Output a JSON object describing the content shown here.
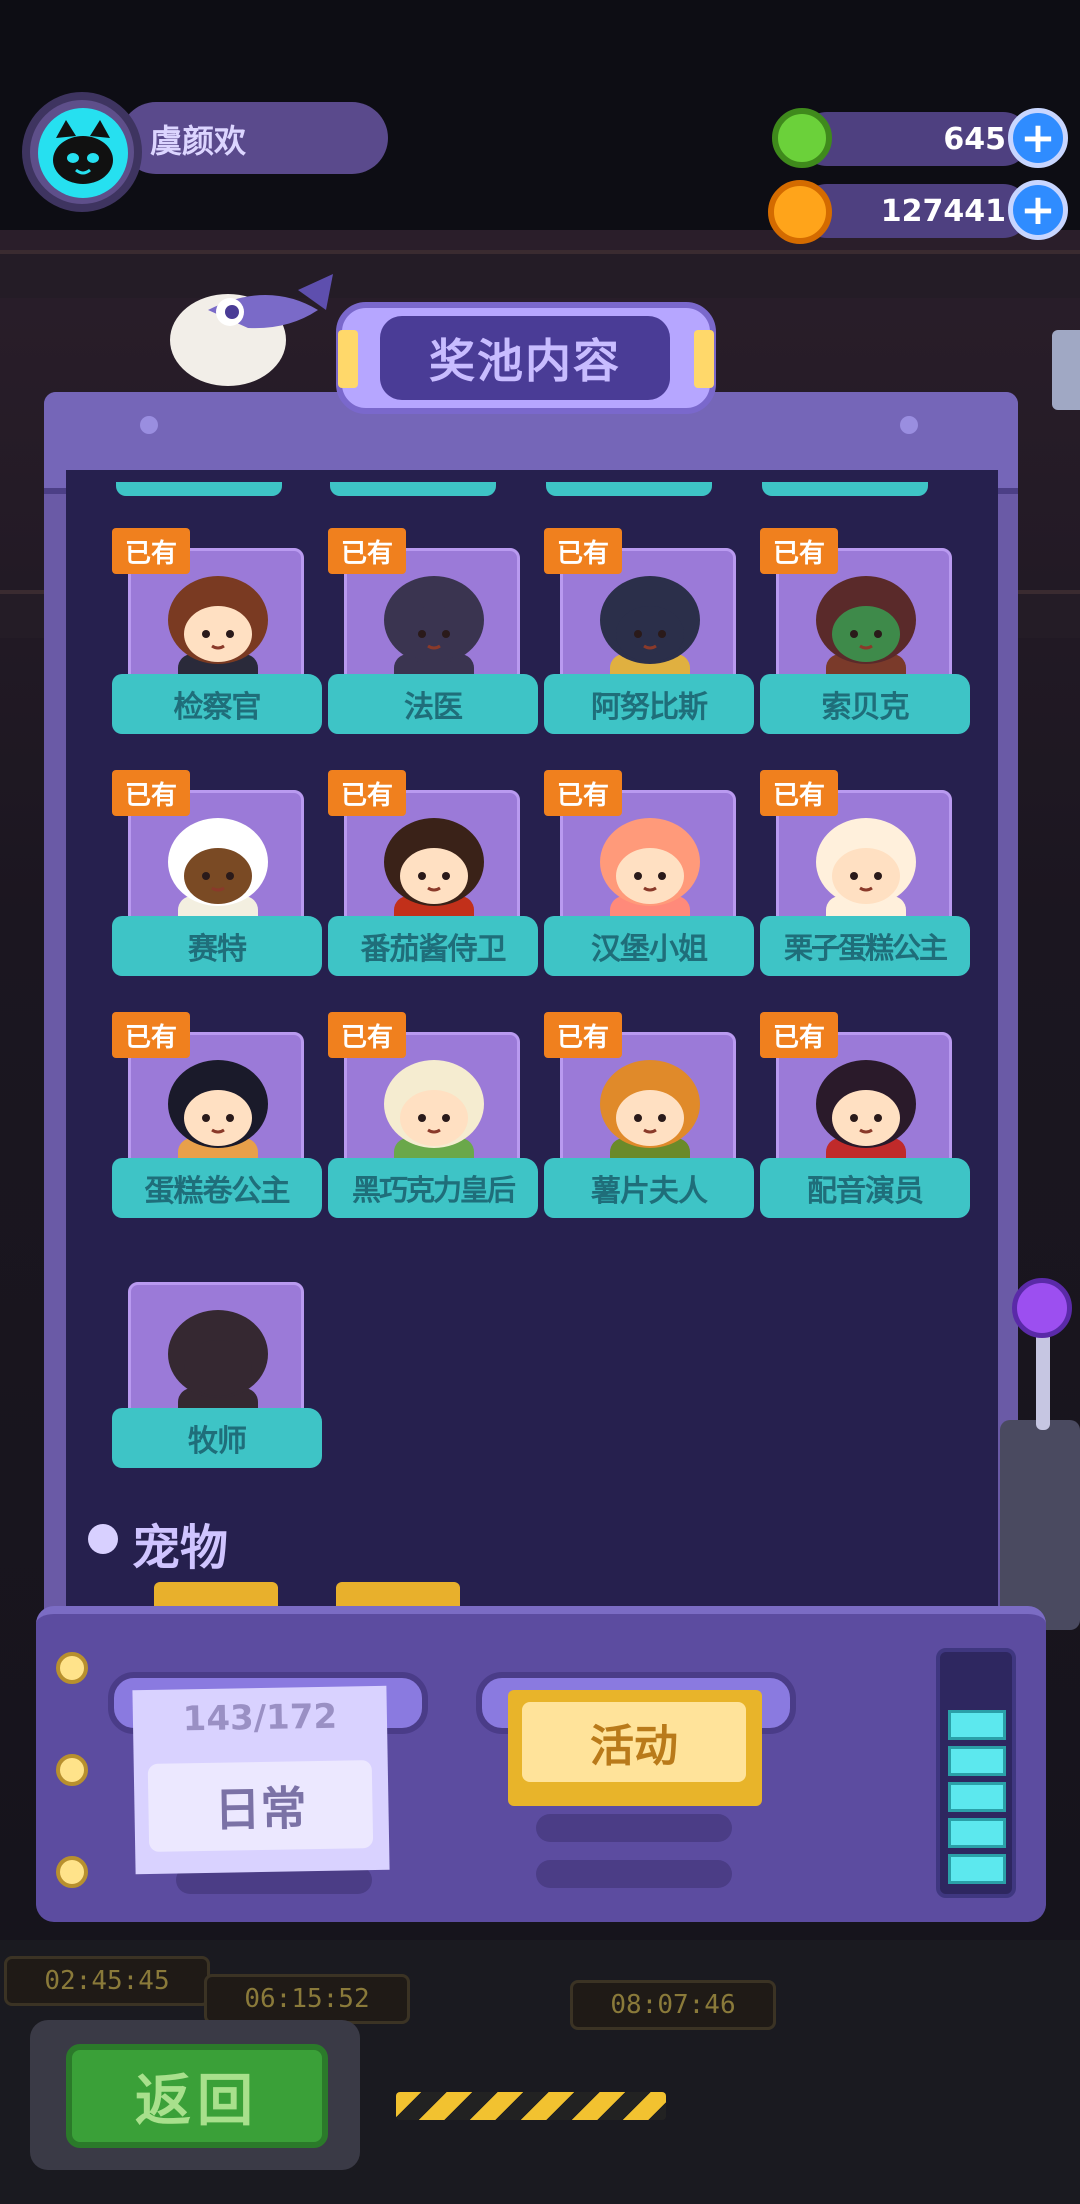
{
  "user": {
    "name": "虞颜欢"
  },
  "currencies": [
    {
      "name": "green-gem",
      "value": "645",
      "color": "#6bd13a"
    },
    {
      "name": "gold-coin",
      "value": "127441",
      "color": "#ffa41a"
    }
  ],
  "panel": {
    "title": "奖池内容"
  },
  "owned_badge": "已有",
  "characters": [
    {
      "name": "检察官",
      "owned": true,
      "hair": "#7a3a22",
      "skin": "#ffe0c2",
      "body": "#2a2a3a"
    },
    {
      "name": "法医",
      "owned": true,
      "hair": "#3a3450",
      "skin": "#3a3450",
      "body": "#3a3450"
    },
    {
      "name": "阿努比斯",
      "owned": true,
      "hair": "#2b2f4a",
      "skin": "#2b2f4a",
      "body": "#e0b040"
    },
    {
      "name": "索贝克",
      "owned": true,
      "hair": "#5a2a2a",
      "skin": "#3e8a4a",
      "body": "#7a3a2a"
    },
    {
      "name": "赛特",
      "owned": true,
      "hair": "#ffffff",
      "skin": "#7a4a24",
      "body": "#f3efe0"
    },
    {
      "name": "番茄酱侍卫",
      "owned": true,
      "hair": "#3a2218",
      "skin": "#ffe0c2",
      "body": "#c2301a"
    },
    {
      "name": "汉堡小姐",
      "owned": true,
      "hair": "#ff9a7a",
      "skin": "#ffe0c2",
      "body": "#ff8a7a"
    },
    {
      "name": "栗子蛋糕公主",
      "owned": true,
      "hair": "#fff0dc",
      "skin": "#ffe0c2",
      "body": "#fff0dc"
    },
    {
      "name": "蛋糕卷公主",
      "owned": true,
      "hair": "#1a1a2a",
      "skin": "#ffe0c2",
      "body": "#e8a04a"
    },
    {
      "name": "黑巧克力皇后",
      "owned": true,
      "hair": "#f5ecd0",
      "skin": "#ffe0c2",
      "body": "#6aa84a"
    },
    {
      "name": "薯片夫人",
      "owned": true,
      "hair": "#e08a2a",
      "skin": "#ffe0c2",
      "body": "#6a8a2a"
    },
    {
      "name": "配音演员",
      "owned": true,
      "hair": "#2a1a2a",
      "skin": "#ffe0c2",
      "body": "#c02a2a"
    },
    {
      "name": "牧师",
      "owned": false,
      "hair": "#2a2020",
      "skin": "#2a2020",
      "body": "#2a2020"
    }
  ],
  "sections": {
    "pets": "宠物"
  },
  "machine": {
    "progress": "143/172",
    "tab_daily": "日常",
    "tab_event": "活动"
  },
  "back_label": "返回"
}
